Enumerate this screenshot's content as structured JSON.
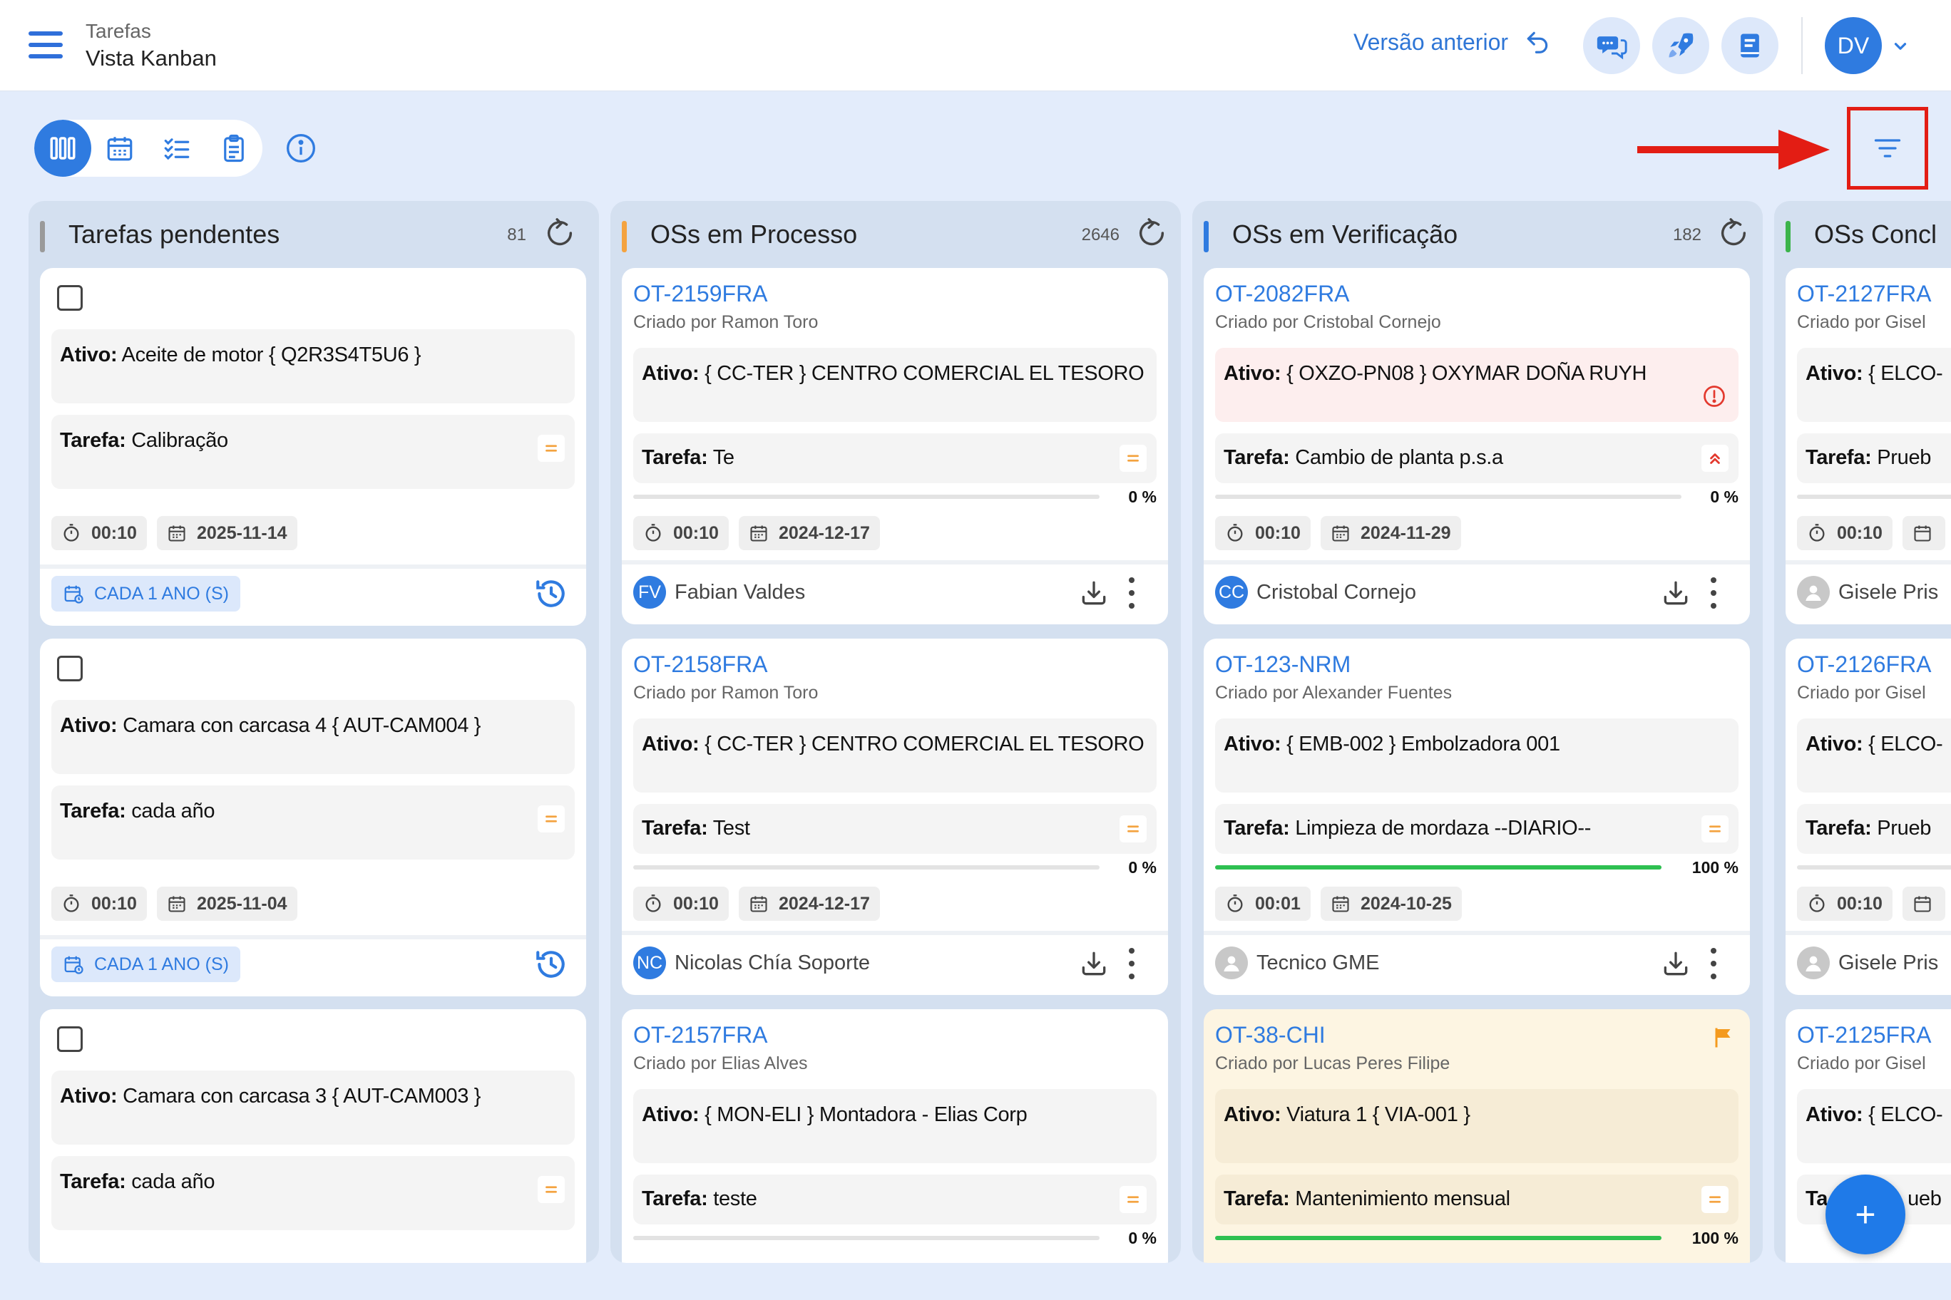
{
  "header": {
    "section": "Tarefas",
    "view": "Vista Kanban",
    "previous_version": "Versão anterior",
    "user_initials": "DV"
  },
  "colors": {
    "primary": "#2f7be0",
    "gray_bar": "#9a9a9a",
    "orange_bar": "#f4a340",
    "blue_bar": "#2f7be0",
    "green_bar": "#3cb44b",
    "progress": "#2ec051",
    "highlight": "#e31d14"
  },
  "columns": [
    {
      "title": "Tarefas pendentes",
      "count": "81"
    },
    {
      "title": "OSs em Processo",
      "count": "2646"
    },
    {
      "title": "OSs em Verificação",
      "count": "182"
    },
    {
      "title": "OSs Concl"
    }
  ],
  "pending": [
    {
      "asset_label": "Ativo:",
      "asset": "Aceite de motor { Q2R3S4T5U6 }",
      "task_label": "Tarefa:",
      "task": "Calibração",
      "time": "00:10",
      "date": "2025-11-14",
      "recurrence": "CADA 1 ANO (S)"
    },
    {
      "asset_label": "Ativo:",
      "asset": "Camara con carcasa 4  { AUT-CAM004 }",
      "task_label": "Tarefa:",
      "task": "cada año",
      "time": "00:10",
      "date": "2025-11-04",
      "recurrence": "CADA 1 ANO (S)"
    },
    {
      "asset_label": "Ativo:",
      "asset": "Camara con carcasa 3  { AUT-CAM003 }",
      "task_label": "Tarefa:",
      "task": "cada año"
    }
  ],
  "process": [
    {
      "id": "OT-2159FRA",
      "creator": "Criado por Ramon Toro",
      "asset_label": "Ativo:",
      "asset": "{ CC-TER } CENTRO COMERCIAL EL TESORO",
      "task_label": "Tarefa:",
      "task": "Te",
      "progress": 0,
      "pct": "0 %",
      "time": "00:10",
      "date": "2024-12-17",
      "assignee_initials": "FV",
      "assignee": "Fabian Valdes"
    },
    {
      "id": "OT-2158FRA",
      "creator": "Criado por Ramon Toro",
      "asset_label": "Ativo:",
      "asset": "{ CC-TER } CENTRO COMERCIAL EL TESORO",
      "task_label": "Tarefa:",
      "task": "Test",
      "progress": 0,
      "pct": "0 %",
      "time": "00:10",
      "date": "2024-12-17",
      "assignee_initials": "NC",
      "assignee": "Nicolas Chía Soporte"
    },
    {
      "id": "OT-2157FRA",
      "creator": "Criado por Elias Alves",
      "asset_label": "Ativo:",
      "asset": "{ MON-ELI } Montadora - Elias Corp",
      "task_label": "Tarefa:",
      "task": "teste",
      "progress": 0,
      "pct": "0 %"
    }
  ],
  "verification": [
    {
      "id": "OT-2082FRA",
      "creator": "Criado por Cristobal Cornejo",
      "asset_label": "Ativo:",
      "asset": "{ OXZO-PN08 } OXYMAR DOÑA RUYH",
      "task_label": "Tarefa:",
      "task": "Cambio de planta p.s.a",
      "progress": 0,
      "pct": "0 %",
      "time": "00:10",
      "date": "2024-11-29",
      "assignee_initials": "CC",
      "assignee": "Cristobal Cornejo"
    },
    {
      "id": "OT-123-NRM",
      "creator": "Criado por Alexander Fuentes",
      "asset_label": "Ativo:",
      "asset": "{ EMB-002 } Embolzadora 001",
      "task_label": "Tarefa:",
      "task": "Limpieza de mordaza --DIARIO--",
      "progress": 1,
      "pct": "100 %",
      "time": "00:01",
      "date": "2024-10-25",
      "assignee": "Tecnico GME"
    },
    {
      "id": "OT-38-CHI",
      "creator": "Criado por Lucas Peres Filipe",
      "asset_label": "Ativo:",
      "asset": "Viatura 1  { VIA-001 }",
      "task_label": "Tarefa:",
      "task": "Mantenimiento mensual",
      "progress": 1,
      "pct": "100 %"
    }
  ],
  "concluded": [
    {
      "id": "OT-2127FRA",
      "creator": "Criado por Gisel",
      "asset_label": "Ativo:",
      "asset": "{ ELCO-",
      "task_label": "Tarefa:",
      "task": "Prueb",
      "time": "00:10",
      "assignee": "Gisele Pris"
    },
    {
      "id": "OT-2126FRA",
      "creator": "Criado por Gisel",
      "asset_label": "Ativo:",
      "asset": "{ ELCO-",
      "task_label": "Tarefa:",
      "task": "Prueb",
      "time": "00:10",
      "assignee": "Gisele Pris"
    },
    {
      "id": "OT-2125FRA",
      "creator": "Criado por Gisel",
      "asset_label": "Ativo:",
      "asset": "{ ELCO-",
      "task_label": "Ta",
      "task": "ueb"
    }
  ],
  "fab_label": "+"
}
